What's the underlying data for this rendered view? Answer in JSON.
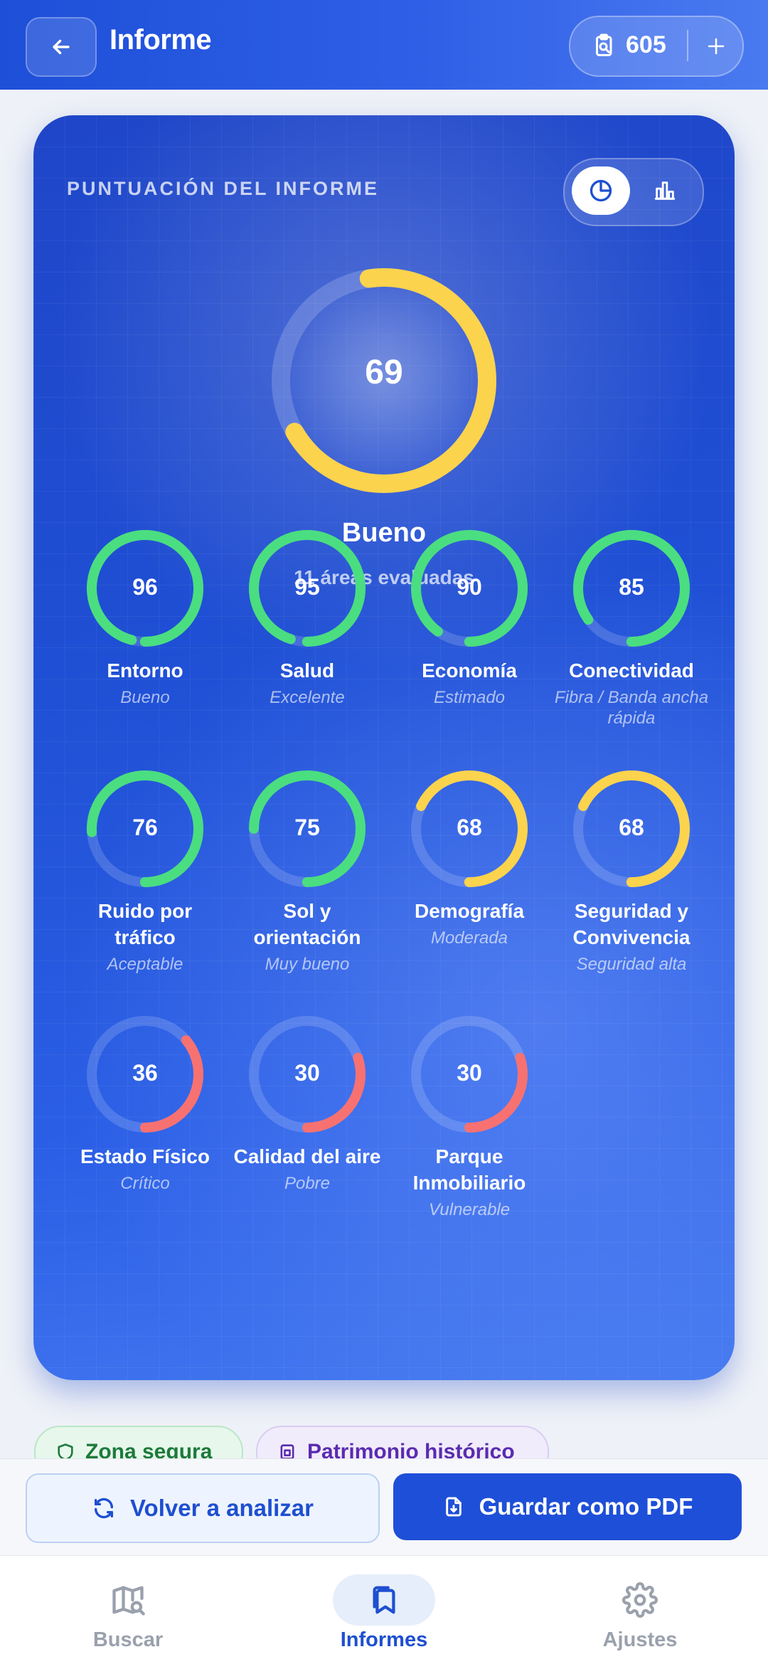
{
  "header": {
    "title": "Informe",
    "credits": "605"
  },
  "card": {
    "label": "PUNTUACIÓN DEL INFORME",
    "score": "69",
    "score_fraction": 0.69,
    "rating": "Bueno",
    "subtitle": "11 áreas evaluadas"
  },
  "metrics": [
    {
      "value": "96",
      "name": "Entorno",
      "status": "Bueno",
      "color": "#4ade80"
    },
    {
      "value": "95",
      "name": "Salud",
      "status": "Excelente",
      "color": "#4ade80"
    },
    {
      "value": "90",
      "name": "Economía",
      "status": "Estimado",
      "color": "#4ade80"
    },
    {
      "value": "85",
      "name": "Conectividad",
      "status": "Fibra / Banda ancha rápida",
      "color": "#4ade80"
    },
    {
      "value": "76",
      "name": "Ruido por tráfico",
      "status": "Aceptable",
      "color": "#4ade80"
    },
    {
      "value": "75",
      "name": "Sol y orientación",
      "status": "Muy bueno",
      "color": "#4ade80"
    },
    {
      "value": "68",
      "name": "Demografía",
      "status": "Moderada",
      "color": "#fcd34d"
    },
    {
      "value": "68",
      "name": "Seguridad y Convivencia",
      "status": "Seguridad alta",
      "color": "#fcd34d"
    },
    {
      "value": "36",
      "name": "Estado Físico",
      "status": "Crítico",
      "color": "#f87171"
    },
    {
      "value": "30",
      "name": "Calidad del aire",
      "status": "Pobre",
      "color": "#f87171"
    },
    {
      "value": "30",
      "name": "Parque Inmobiliario",
      "status": "Vulnerable",
      "color": "#f87171"
    }
  ],
  "chips": {
    "safe": "Zona segura",
    "heritage": "Patrimonio histórico"
  },
  "actions": {
    "reanalyze": "Volver a analizar",
    "save_pdf": "Guardar como PDF"
  },
  "nav": {
    "search": "Buscar",
    "reports": "Informes",
    "settings": "Ajustes"
  }
}
